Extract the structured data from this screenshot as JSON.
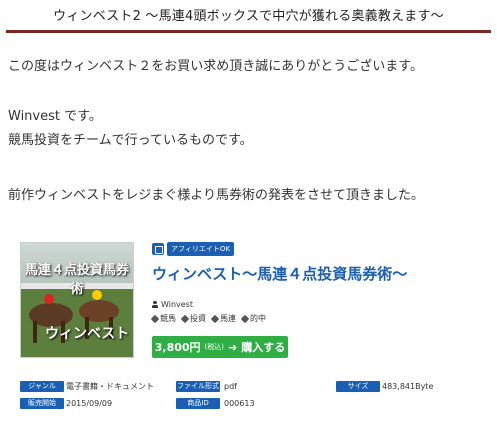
{
  "header": {
    "title": "ウィンベスト2 ～馬連4頭ボックスで中穴が獲れる奥義教えます～"
  },
  "body": {
    "p1": "この度はウィンベスト２をお買い求め頂き誠にありがとうございます。",
    "p2": "Winvest です。",
    "p3": "競馬投資をチームで行っているものです。",
    "p4": "前作ウィンベストをレジまぐ様より馬券術の発表をさせて頂きました。"
  },
  "product": {
    "image_title": "馬連４点投資馬券術",
    "image_logo": "ウィンベスト",
    "badge": "アフィリエイトOK",
    "title": "ウィンベスト～馬連４点投資馬券術～",
    "author": "Winvest",
    "tags": [
      "競馬",
      "投資",
      "馬連",
      "的中"
    ],
    "price": "3,800円",
    "tax": "(税込)",
    "buy_label": "購入する",
    "colors": {
      "accent": "#1a5fb4",
      "buy": "#2fae43",
      "header_rule": "#7a2a22"
    }
  },
  "meta": {
    "genre_label": "ジャンル",
    "genre_value": "電子書籍・ドキュメント",
    "format_label": "ファイル形式",
    "format_value": "pdf",
    "size_label": "サイズ",
    "size_value": "483,841Byte",
    "date_label": "販売開始",
    "date_value": "2015/09/09",
    "id_label": "商品ID",
    "id_value": "000613"
  }
}
